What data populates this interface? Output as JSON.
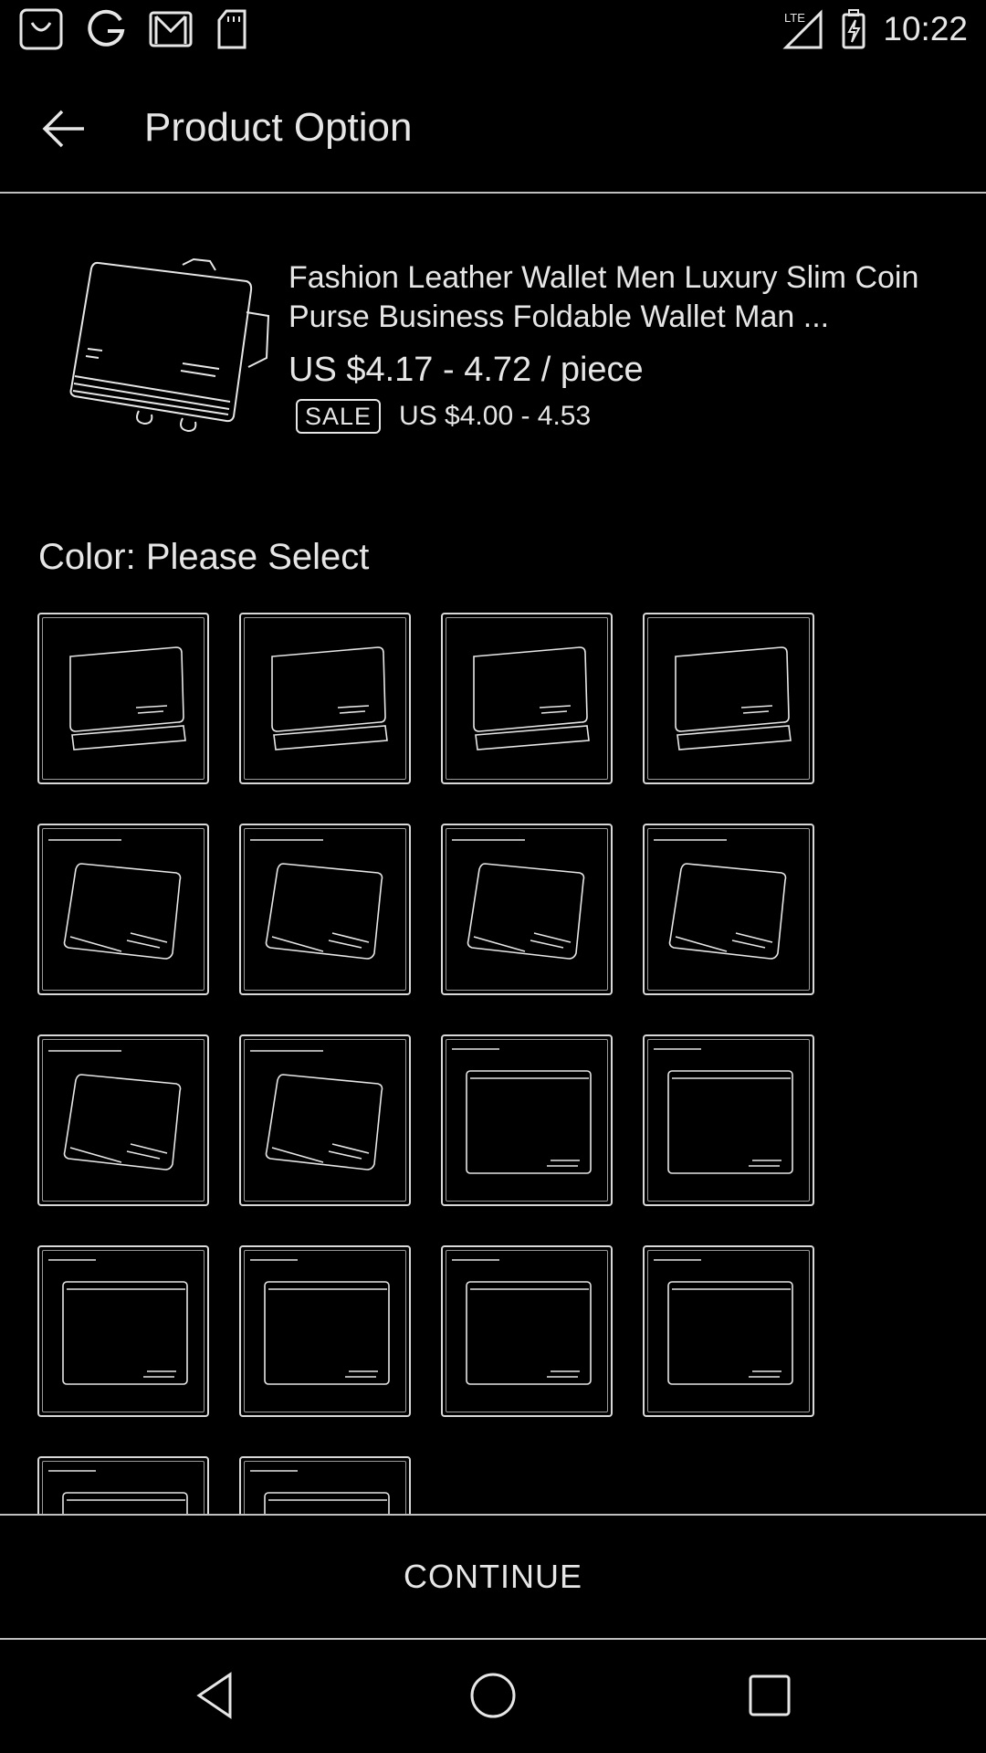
{
  "status_bar": {
    "time": "10:22",
    "left_icons": [
      "shopping-bag-icon",
      "google-icon",
      "gmail-icon",
      "sd-card-icon"
    ],
    "right_icons": [
      "lte-signal-icon",
      "battery-charging-icon"
    ]
  },
  "app_bar": {
    "title": "Product Option",
    "back_icon": "arrow-back-icon"
  },
  "product": {
    "title": "Fashion Leather Wallet Men Luxury Slim Coin Purse Business Foldable Wallet Man ...",
    "price_range": "US $4.17 - 4.72 / piece",
    "sale_badge": "SALE",
    "sale_price": "US $4.00 - 4.53"
  },
  "options": {
    "color_label": "Color: Please Select",
    "swatch_count": 18
  },
  "footer": {
    "continue_label": "CONTINUE"
  },
  "nav_bar": {
    "icons": [
      "nav-back-icon",
      "nav-home-icon",
      "nav-recents-icon"
    ]
  },
  "colors": {
    "background": "#000000",
    "foreground": "#e6e6e6",
    "divider": "#bfbfbf"
  }
}
